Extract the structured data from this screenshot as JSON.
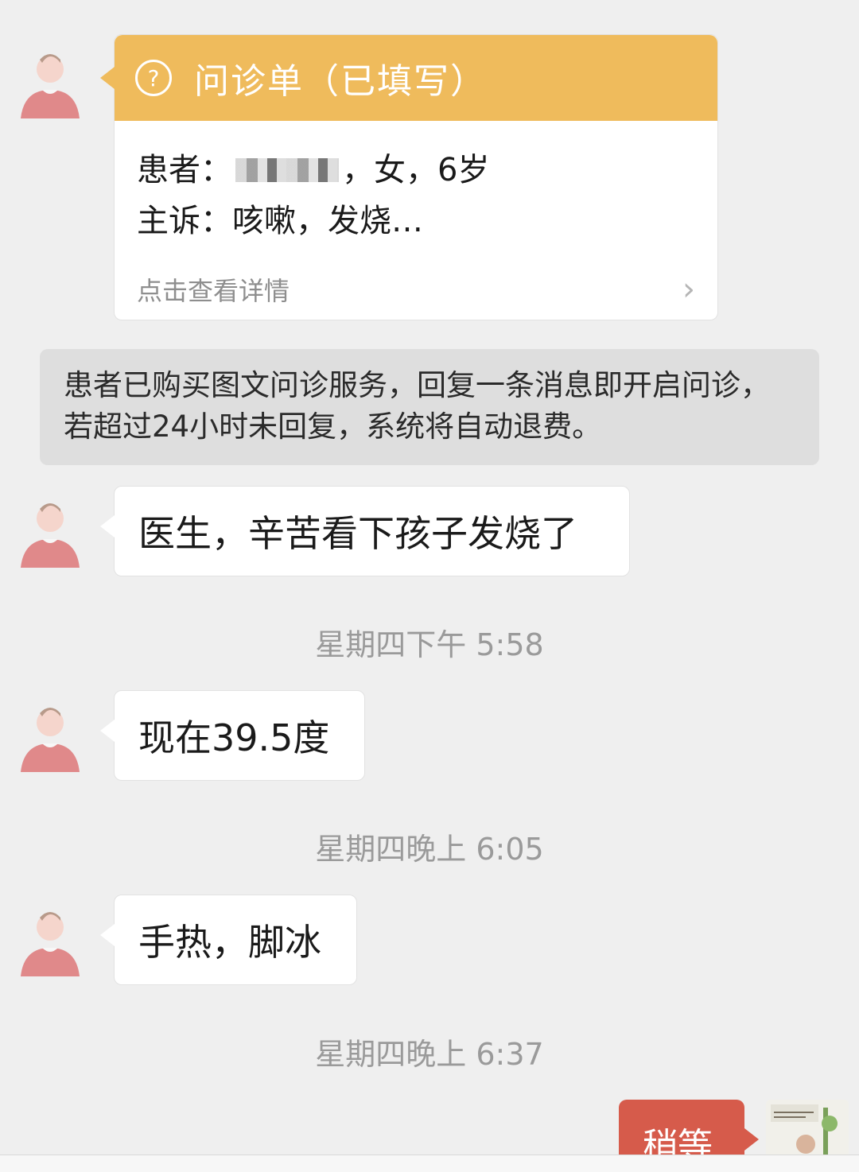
{
  "consult_form": {
    "title": "问诊单（已填写）",
    "patient_label": "患者：",
    "patient_info": "，女，6岁",
    "complaint_label": "主诉：",
    "complaint": "咳嗽，发烧…",
    "detail_link": "点击查看详情"
  },
  "system_notice": "患者已购买图文问诊服务，回复一条消息即开启问诊，若超过24小时未回复，系统将自动退费。",
  "messages": [
    {
      "text": "医生，辛苦看下孩子发烧了"
    },
    {
      "time": "星期四下午 5:58"
    },
    {
      "text": "现在39.5度"
    },
    {
      "time": "星期四晚上 6:05"
    },
    {
      "text": "手热，脚冰"
    },
    {
      "time": "星期四晚上 6:37"
    }
  ],
  "outgoing": {
    "text": "稍等"
  },
  "colors": {
    "form_header": "#efbb5c",
    "outgoing_bubble": "#d65b4b",
    "background": "#efefef"
  }
}
